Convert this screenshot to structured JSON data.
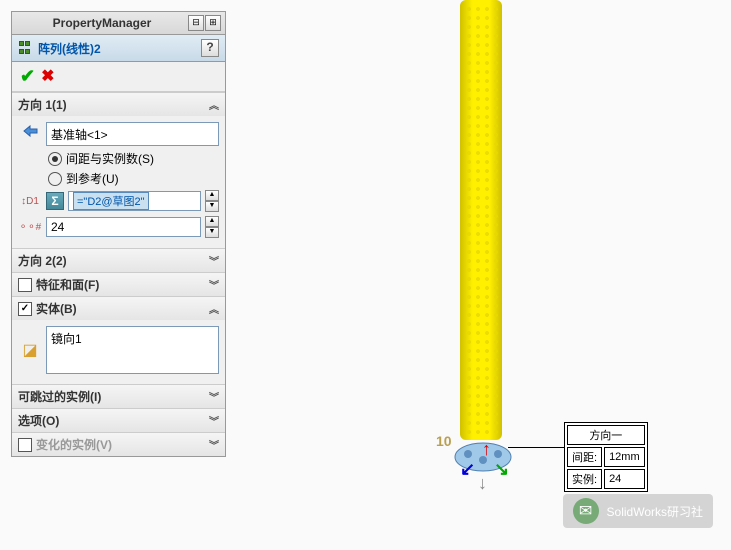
{
  "header": {
    "title": "PropertyManager"
  },
  "feature": {
    "title": "阵列(线性)2"
  },
  "dir1": {
    "title": "方向 1(1)",
    "axis": "基准轴<1>",
    "opt_spacing": "间距与实例数(S)",
    "opt_upto": "到参考(U)",
    "formula": "=\"D2@草图2\"",
    "count": "24"
  },
  "dir2": {
    "title": "方向 2(2)"
  },
  "features_faces": {
    "title": "特征和面(F)"
  },
  "bodies": {
    "title": "实体(B)",
    "item": "镜向1"
  },
  "skip": {
    "title": "可跳过的实例(I)"
  },
  "options": {
    "title": "选项(O)"
  },
  "varied": {
    "title": "变化的实例(V)"
  },
  "callout": {
    "title": "方向一",
    "spacing_lbl": "间距:",
    "spacing_val": "12mm",
    "count_lbl": "实例:",
    "count_val": "24"
  },
  "viewport": {
    "dim_num": "10"
  },
  "watermark": {
    "text": "SolidWorks研习社"
  }
}
